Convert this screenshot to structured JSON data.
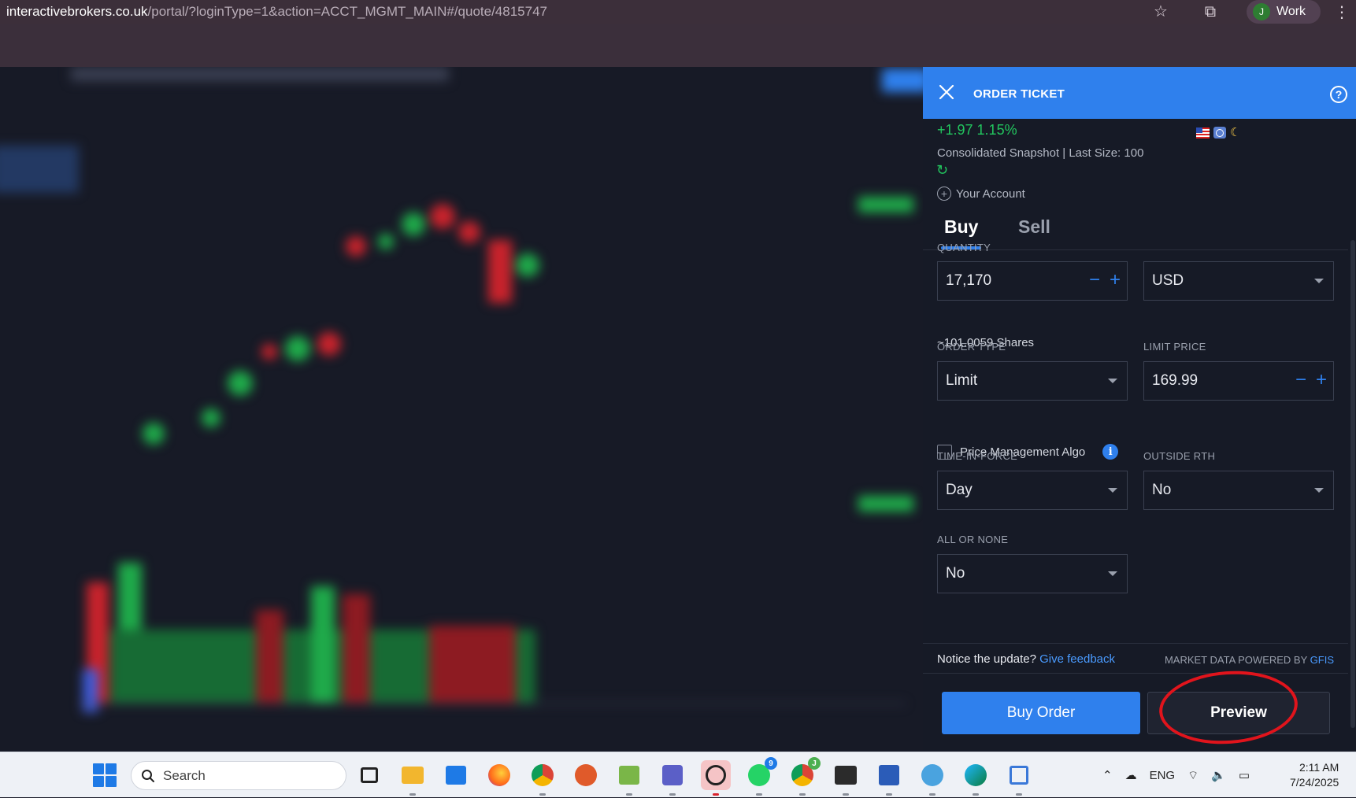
{
  "browser": {
    "url_host": "interactivebrokers.co.uk",
    "url_path": "/portal/?loginType=1&action=ACCT_MGMT_MAIN#/quote/4815747",
    "profile_initial": "J",
    "profile_label": "Work"
  },
  "ticket": {
    "title": "ORDER TICKET",
    "change": "+1.97 1.15%",
    "snapshot": "Consolidated Snapshot | Last Size: 100",
    "your_account": "Your Account",
    "tabs": {
      "buy": "Buy",
      "sell": "Sell",
      "selected": "Buy"
    },
    "quantity": {
      "label": "QUANTITY",
      "value": "17,170",
      "currency": "USD",
      "approx_prefix": "~",
      "approx_value": "101.0059",
      "approx_unit": "Shares"
    },
    "order_type": {
      "label": "ORDER TYPE",
      "value": "Limit"
    },
    "limit_price": {
      "label": "LIMIT PRICE",
      "value": "169.99"
    },
    "price_management_algo": {
      "label": "Price Management Algo",
      "checked": false
    },
    "time_in_force": {
      "label": "TIME-IN-FORCE",
      "value": "Day"
    },
    "outside_rth": {
      "label": "OUTSIDE RTH",
      "value": "No"
    },
    "all_or_none": {
      "label": "ALL OR NONE",
      "value": "No"
    },
    "footer": {
      "notice": "Notice the update?",
      "feedback_link": "Give feedback",
      "powered_by": "MARKET DATA POWERED BY",
      "powered_by_brand": "GFIS"
    },
    "buttons": {
      "buy_order": "Buy Order",
      "preview": "Preview"
    },
    "colors": {
      "accent": "#2f80ed",
      "positive": "#22c55e",
      "annotation": "#e1141c"
    }
  },
  "taskbar": {
    "search_placeholder": "Search",
    "badges": {
      "whatsapp": "9",
      "chrome_profile": "J"
    },
    "tray_language": "ENG",
    "time": "2:11 AM",
    "date": "7/24/2025"
  }
}
